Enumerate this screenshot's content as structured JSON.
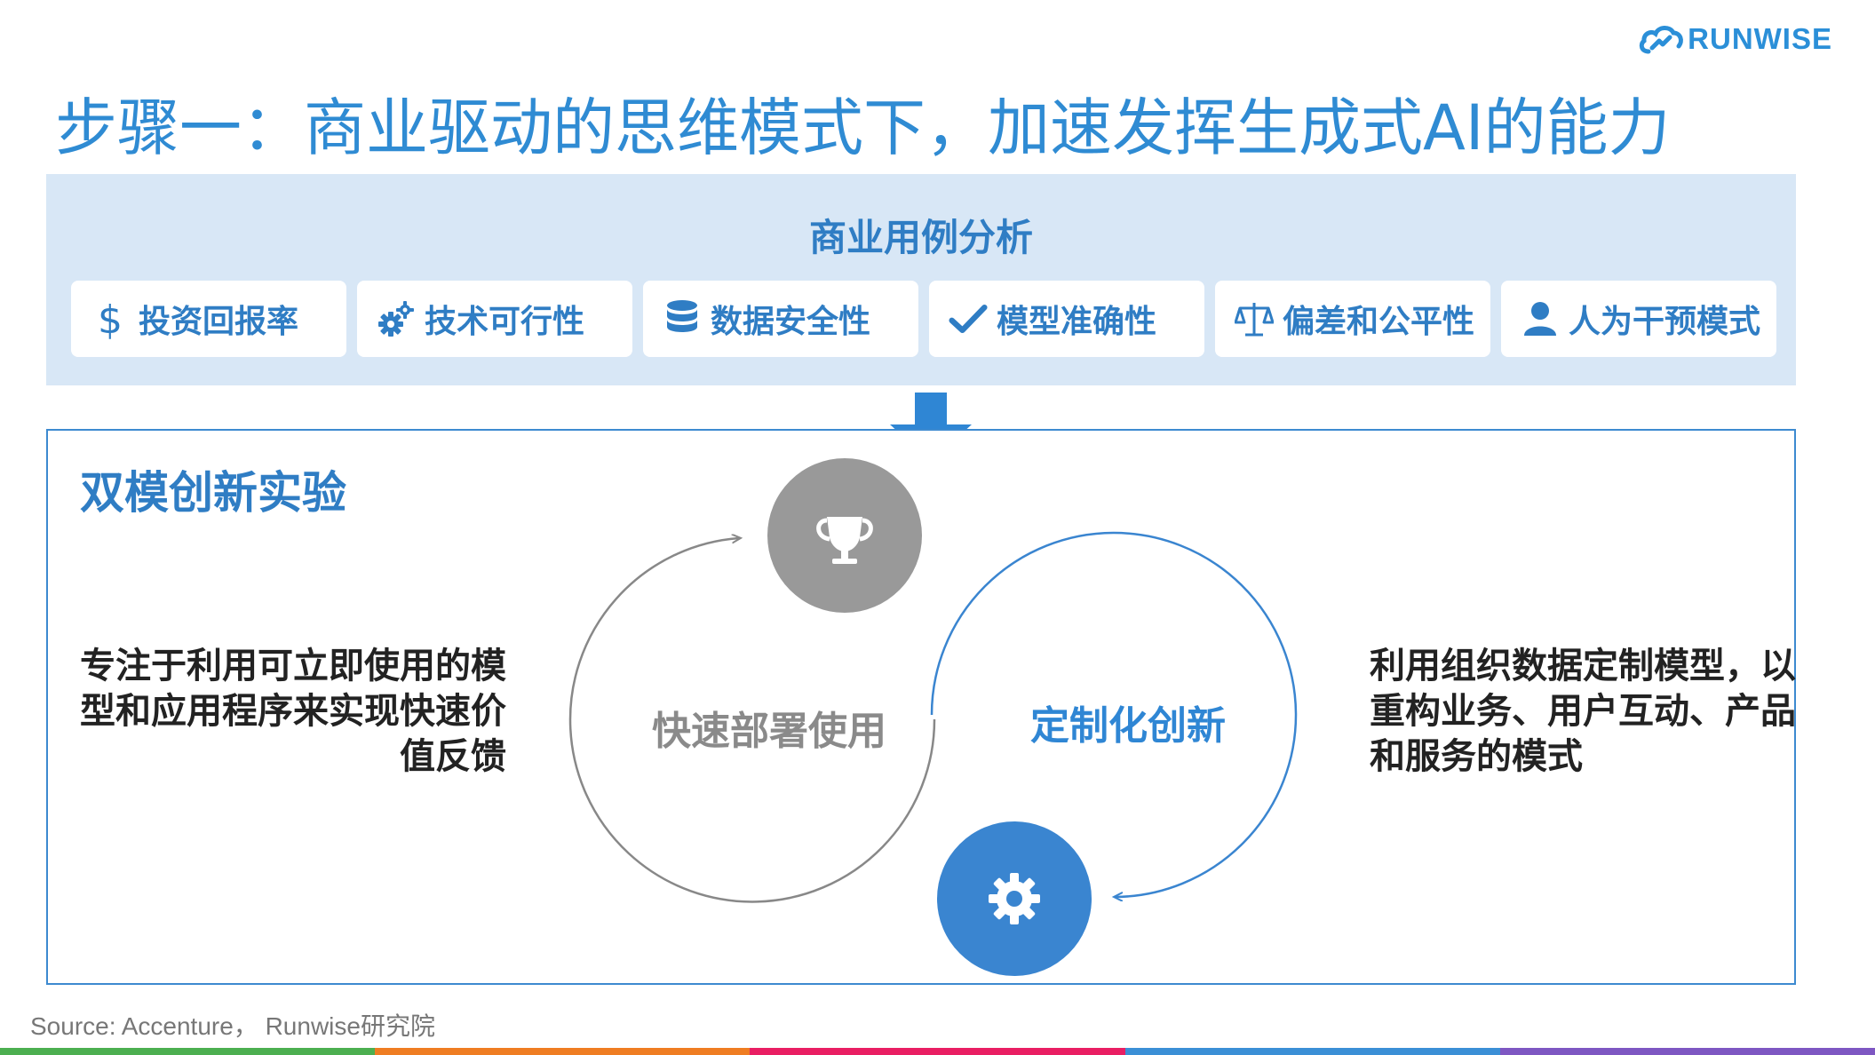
{
  "logo": {
    "text": "RUNWISE"
  },
  "title": "步骤一：商业驱动的思维模式下，加速发挥生成式AI的能力",
  "business_panel": {
    "title": "商业用例分析",
    "items": [
      {
        "icon": "dollar-icon",
        "label": "投资回报率"
      },
      {
        "icon": "gears-icon",
        "label": "技术可行性"
      },
      {
        "icon": "database-icon",
        "label": "数据安全性"
      },
      {
        "icon": "checkmark-icon",
        "label": "模型准确性"
      },
      {
        "icon": "balance-scale-icon",
        "label": "偏差和公平性"
      },
      {
        "icon": "person-icon",
        "label": "人为干预模式"
      }
    ]
  },
  "dual_mode": {
    "title": "双模创新实验",
    "left_description": "专注于利用可立即使用的模型和应用程序来实现快速价值反馈",
    "right_description": "利用组织数据定制模型，以重构业务、用户互动、产品和服务的模式",
    "loop_left_label": "快速部署使用",
    "loop_right_label": "定制化创新",
    "top_icon": "trophy-icon",
    "bottom_icon": "gear-icon"
  },
  "source": "Source: Accenture， Runwise研究院",
  "colors": {
    "primary_blue": "#2f8bd3",
    "panel_bg": "#d8e7f6",
    "gray_circle": "#999999",
    "blue_circle": "#3a85d0",
    "bottom_bar": [
      "#4caf50",
      "#ef7d22",
      "#e91e63",
      "#3b8fd6",
      "#7e57c2"
    ]
  }
}
